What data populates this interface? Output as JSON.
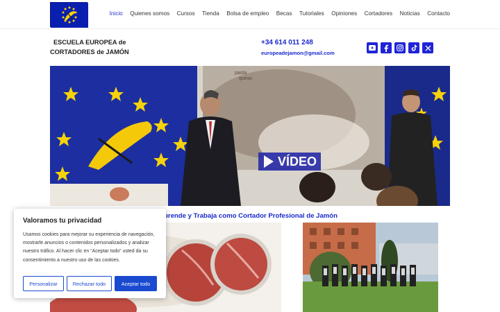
{
  "header": {
    "nav": [
      "Inicio",
      "Quienes somos",
      "Cursos",
      "Tienda",
      "Bolsa de empleo",
      "Becas",
      "Tutoriales",
      "Opiniones",
      "Cortadores",
      "Noticias",
      "Contacto"
    ],
    "active": "Inicio"
  },
  "info": {
    "school_line1": "ESCUELA EUROPEA de",
    "school_line2": "CORTADORES de JAMÓN",
    "phone": "+34 614 011 248",
    "email": "europeadejamon@gmail.com"
  },
  "socials": [
    "youtube-icon",
    "facebook-icon",
    "instagram-icon",
    "tiktok-icon",
    "x-icon"
  ],
  "hero": {
    "video_label": "VÍDEO",
    "screen_text": "pasta\nqueso"
  },
  "subtitle": "prende y Trabaja como Cortador Profesional de Jamón",
  "cookie": {
    "title": "Valoramos tu privacidad",
    "text": "Usamos cookies para mejorar su experiencia de navegación, mostrarle anuncios o contenidos personalizados y analizar nuestro tráfico. Al hacer clic en “Aceptar todo” usted da su consentimiento a nuestro uso de las cookies.",
    "btn_customize": "Personalizar",
    "btn_reject": "Rechazar todo",
    "btn_accept": "Aceptar todo"
  },
  "colors": {
    "brand_blue": "#1a2acc",
    "button_blue": "#1a4ad0",
    "flag_blue": "#0a1fb0",
    "star_yellow": "#f6d20a"
  }
}
